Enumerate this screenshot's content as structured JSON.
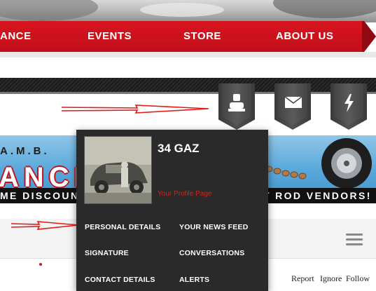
{
  "nav": {
    "items": [
      {
        "label": "ANCE"
      },
      {
        "label": "EVENTS"
      },
      {
        "label": "STORE"
      },
      {
        "label": "ABOUT US"
      }
    ]
  },
  "banner": {
    "top_text": "A.M.B.",
    "big_text": "ANCE",
    "strip_text": "ME DISCOUNTS FROM YOUR FAVORITE HOT ROD VENDORS!"
  },
  "icon_tabs": [
    {
      "icon": "user-icon"
    },
    {
      "icon": "envelope-icon"
    },
    {
      "icon": "lightning-icon"
    }
  ],
  "popup": {
    "username": "34 GAZ",
    "profile_link": "Your Profile Page",
    "left_menu": [
      "PERSONAL DETAILS",
      "SIGNATURE",
      "CONTACT DETAILS"
    ],
    "right_menu": [
      "YOUR NEWS FEED",
      "CONVERSATIONS",
      "ALERTS"
    ]
  },
  "post_actions": {
    "report": "Report",
    "ignore": "Ignore",
    "follow": "Follow"
  },
  "colors": {
    "nav_red": "#c0101a",
    "popup_bg": "#2a2a2a",
    "link_red": "#d4231e",
    "arrow_red": "#e21b1b"
  }
}
